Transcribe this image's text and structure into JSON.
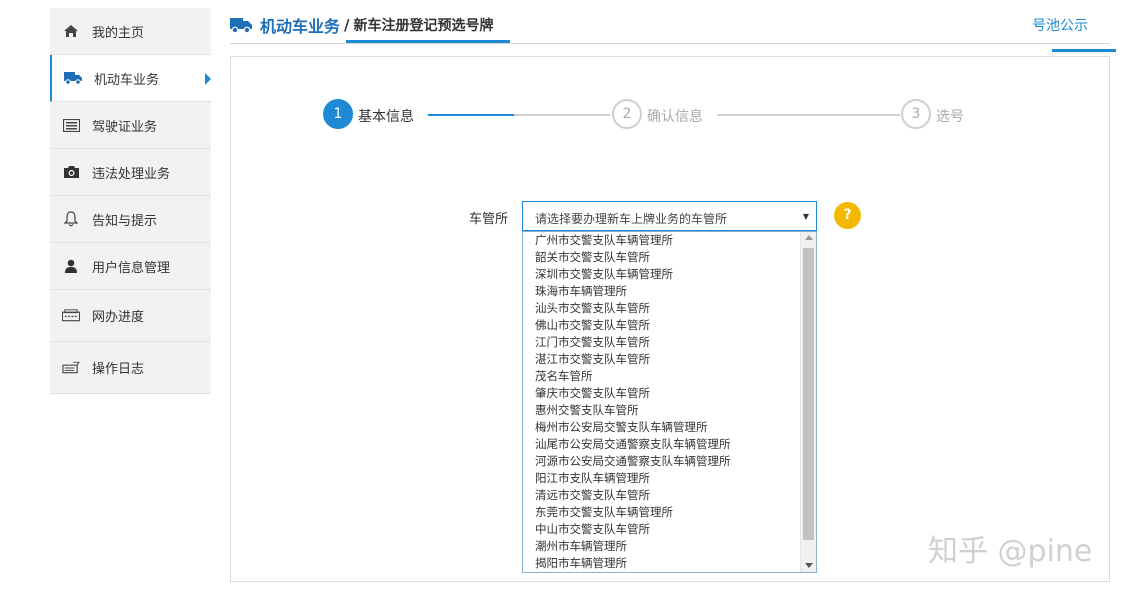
{
  "sidebar": {
    "items": [
      {
        "label": "我的主页",
        "icon": "home-icon"
      },
      {
        "label": "机动车业务",
        "icon": "truck-icon",
        "active": true
      },
      {
        "label": "驾驶证业务",
        "icon": "license-card-icon"
      },
      {
        "label": "违法处理业务",
        "icon": "camera-icon"
      },
      {
        "label": "告知与提示",
        "icon": "bell-icon"
      },
      {
        "label": "用户信息管理",
        "icon": "user-icon"
      },
      {
        "label": "网办进度",
        "icon": "progress-icon"
      },
      {
        "label": "操作日志",
        "icon": "log-icon"
      }
    ]
  },
  "header": {
    "title": "机动车业务",
    "separator": "/",
    "subtitle": "新车注册登记预选号牌",
    "pool_link": "号池公示"
  },
  "steps": [
    {
      "number": "1",
      "label": "基本信息",
      "state": "current"
    },
    {
      "number": "2",
      "label": "确认信息",
      "state": "pending"
    },
    {
      "number": "3",
      "label": "选号",
      "state": "pending"
    }
  ],
  "form": {
    "label": "车管所",
    "select_placeholder": "请选择要办理新车上牌业务的车管所",
    "help": "?",
    "options": [
      "广州市交警支队车辆管理所",
      "韶关市交警支队车管所",
      "深圳市交警支队车辆管理所",
      "珠海市车辆管理所",
      "汕头市交警支队车管所",
      "佛山市交警支队车管所",
      "江门市交警支队车管所",
      "湛江市交警支队车管所",
      "茂名车管所",
      "肇庆市交警支队车管所",
      "惠州交警支队车管所",
      "梅州市公安局交警支队车辆管理所",
      "汕尾市公安局交通警察支队车辆管理所",
      "河源市公安局交通警察支队车辆管理所",
      "阳江市支队车辆管理所",
      "清远市交警支队车管所",
      "东莞市交警支队车辆管理所",
      "中山市交警支队车管所",
      "潮州市车辆管理所",
      "揭阳市车辆管理所"
    ]
  },
  "watermark": "知乎 @pine",
  "colors": {
    "accent": "#1e8ad6",
    "title": "#1e6fb8",
    "help": "#f5b800"
  }
}
